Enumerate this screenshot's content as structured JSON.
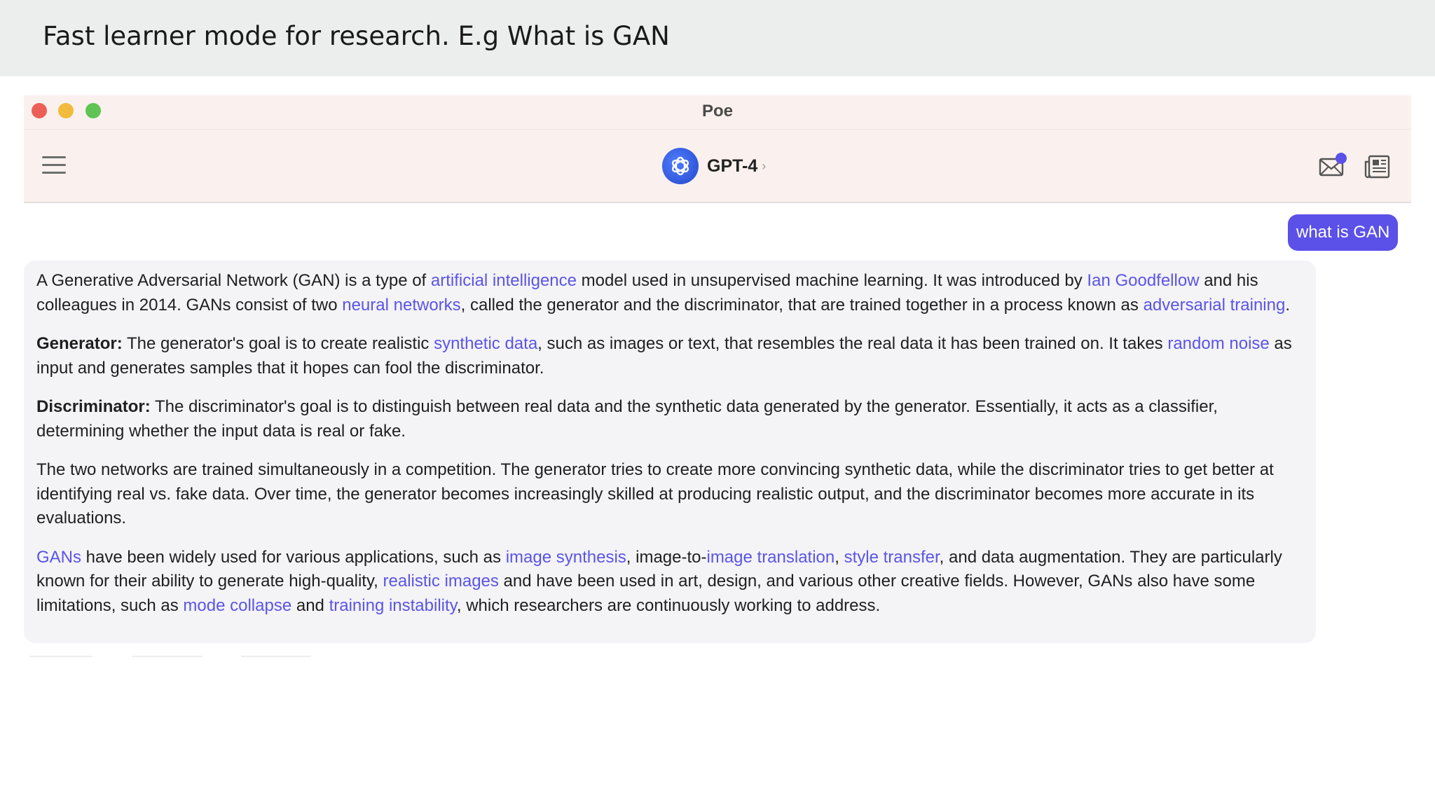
{
  "slide": {
    "title": "Fast learner mode for research. E.g What is  GAN"
  },
  "window": {
    "title": "Poe"
  },
  "toolbar": {
    "bot_name": "GPT-4",
    "chevron": "›",
    "menu_icon": "hamburger-menu-icon",
    "mail_icon": "mail-notification-icon",
    "news_icon": "newspaper-icon"
  },
  "colors": {
    "user_bubble": "#5b50e8",
    "link": "#5a55e6",
    "answer_bg": "#f4f3f6",
    "header_bg": "#eceeee",
    "titlebar_bg": "#faf1ee"
  },
  "chat": {
    "user_message": "what is GAN",
    "answer": {
      "p1": [
        {
          "t": "A Generative Adversarial Network (GAN) is a type of "
        },
        {
          "t": "artificial intelligence",
          "link": true
        },
        {
          "t": " model used in unsupervised machine learning. It was introduced by "
        },
        {
          "t": "Ian Goodfellow",
          "link": true
        },
        {
          "t": " and his colleagues in 2014. GANs consist of two "
        },
        {
          "t": "neural networks",
          "link": true
        },
        {
          "t": ", called the generator and the discriminator, that are trained together in a process known as "
        },
        {
          "t": "adversarial training",
          "link": true
        },
        {
          "t": "."
        }
      ],
      "p2": [
        {
          "t": "Generator:",
          "bold": true
        },
        {
          "t": " The generator's goal is to create realistic "
        },
        {
          "t": "synthetic data",
          "link": true
        },
        {
          "t": ", such as images or text, that resembles the real data it has been trained on. It takes "
        },
        {
          "t": "random noise",
          "link": true
        },
        {
          "t": " as input and generates samples that it hopes can fool the discriminator."
        }
      ],
      "p3": [
        {
          "t": "Discriminator:",
          "bold": true
        },
        {
          "t": " The discriminator's goal is to distinguish between real data and the synthetic data generated by the generator. Essentially, it acts as a classifier, determining whether the input data is real or fake."
        }
      ],
      "p4": [
        {
          "t": "The two networks are trained simultaneously in a competition. The generator tries to create more convincing synthetic data, while the discriminator tries to get better at identifying real vs. fake data. Over time, the generator becomes increasingly skilled at producing realistic output, and the discriminator becomes more accurate in its evaluations."
        }
      ],
      "p5": [
        {
          "t": "GANs",
          "link": true
        },
        {
          "t": " have been widely used for various applications, such as "
        },
        {
          "t": "image synthesis",
          "link": true
        },
        {
          "t": ", image-to-"
        },
        {
          "t": "image translation",
          "link": true
        },
        {
          "t": ", "
        },
        {
          "t": "style transfer",
          "link": true
        },
        {
          "t": ", and data augmentation. They are particularly known for their ability to generate high-quality, "
        },
        {
          "t": "realistic images",
          "link": true
        },
        {
          "t": " and have been used in art, design, and various other creative fields. However, GANs also have some limitations, such as "
        },
        {
          "t": "mode collapse",
          "link": true
        },
        {
          "t": " and "
        },
        {
          "t": "training instability",
          "link": true
        },
        {
          "t": ", which researchers are continuously working to address."
        }
      ]
    }
  }
}
